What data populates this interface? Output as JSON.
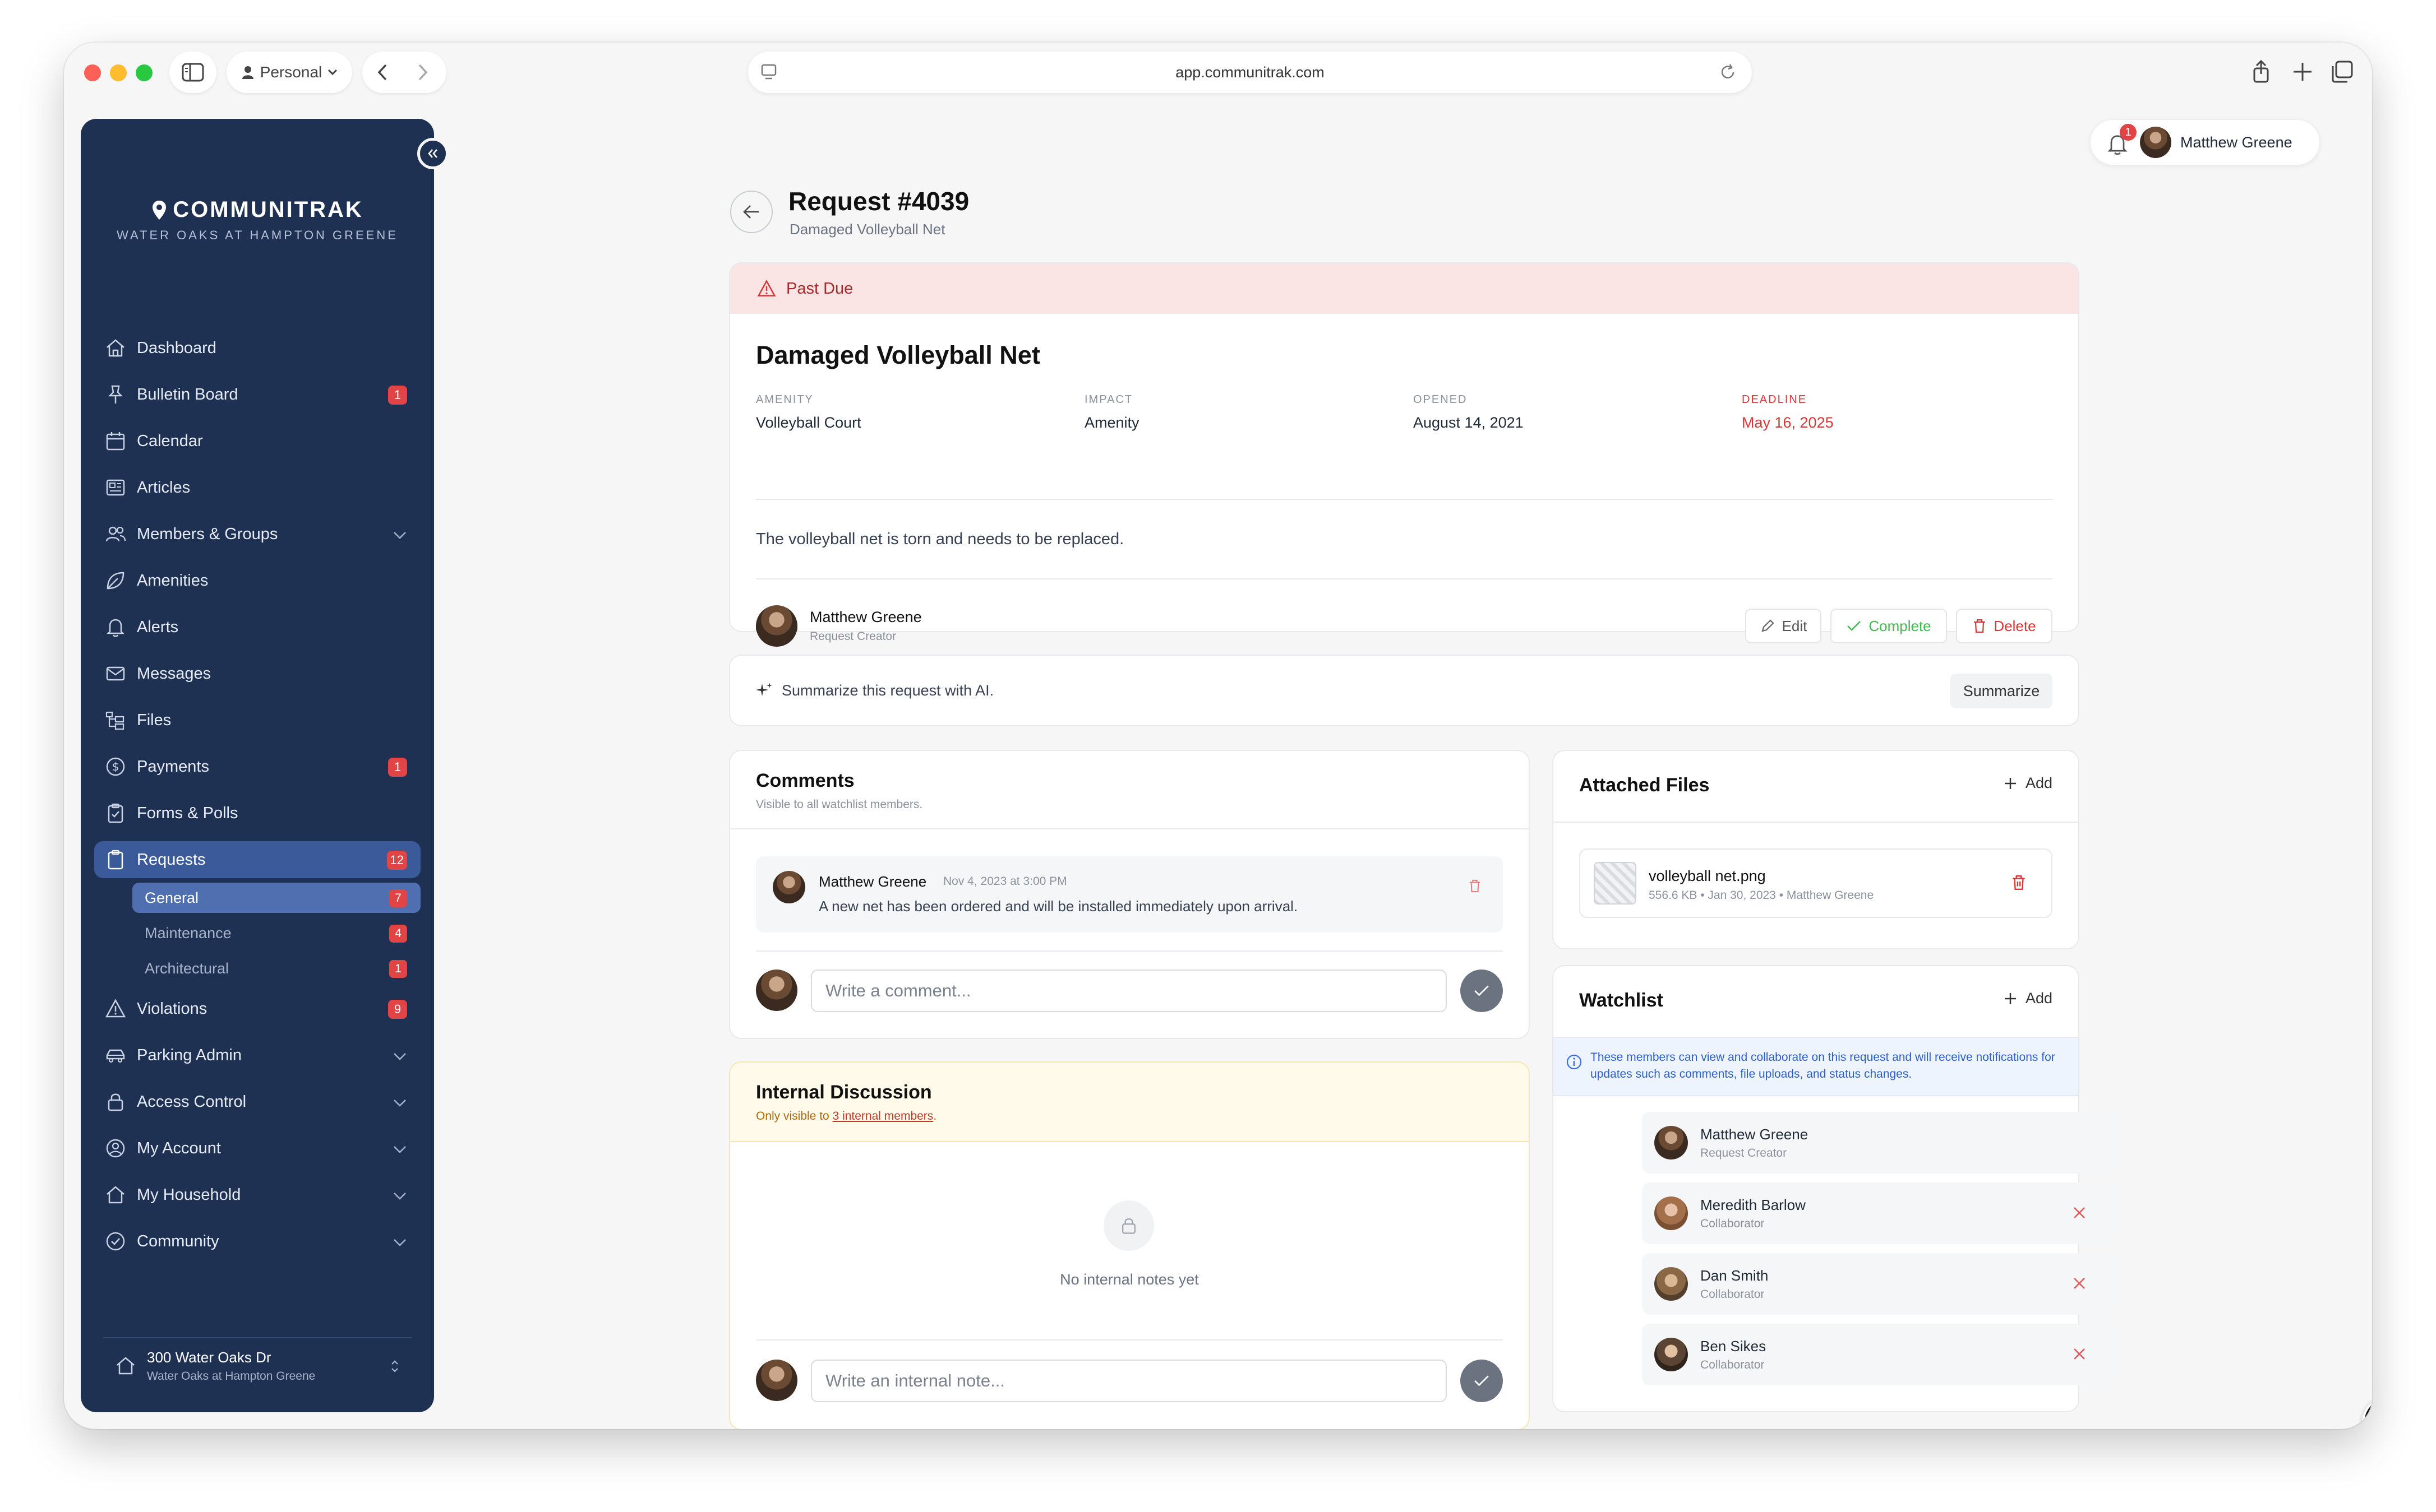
{
  "browser": {
    "profile": "Personal",
    "url": "app.communitrak.com"
  },
  "brand": {
    "name": "COMMUNITRAK",
    "community": "WATER OAKS AT HAMPTON GREENE"
  },
  "nav": {
    "dashboard": "Dashboard",
    "bulletin": "Bulletin Board",
    "bulletin_badge": "1",
    "calendar": "Calendar",
    "articles": "Articles",
    "members": "Members & Groups",
    "amenities": "Amenities",
    "alerts": "Alerts",
    "messages": "Messages",
    "files": "Files",
    "payments": "Payments",
    "payments_badge": "1",
    "forms": "Forms & Polls",
    "requests": "Requests",
    "requests_badge": "12",
    "general": "General",
    "general_badge": "7",
    "maintenance": "Maintenance",
    "maintenance_badge": "4",
    "architectural": "Architectural",
    "architectural_badge": "1",
    "violations": "Violations",
    "violations_badge": "9",
    "parking": "Parking Admin",
    "access": "Access Control",
    "account": "My Account",
    "household": "My Household",
    "community": "Community"
  },
  "footer": {
    "address": "300 Water Oaks Dr",
    "community": "Water Oaks at Hampton Greene"
  },
  "user": {
    "name": "Matthew Greene",
    "notif_count": "1"
  },
  "request": {
    "title": "Request #4039",
    "subtitle": "Damaged Volleyball Net",
    "status": "Past Due",
    "heading": "Damaged Volleyball Net",
    "fields": {
      "amenity_label": "AMENITY",
      "amenity_value": "Volleyball Court",
      "impact_label": "IMPACT",
      "impact_value": "Amenity",
      "opened_label": "OPENED",
      "opened_value": "August 14, 2021",
      "deadline_label": "DEADLINE",
      "deadline_value": "May 16, 2025"
    },
    "description": "The volleyball net is torn and needs to be replaced.",
    "creator_name": "Matthew Greene",
    "creator_role": "Request Creator",
    "edit": "Edit",
    "complete": "Complete",
    "delete": "Delete"
  },
  "ai": {
    "prompt": "Summarize this request with AI.",
    "button": "Summarize"
  },
  "comments": {
    "title": "Comments",
    "subtitle": "Visible to all watchlist members.",
    "items": [
      {
        "author": "Matthew Greene",
        "time": "Nov 4, 2023 at 3:00 PM",
        "text": "A new net has been ordered and will be installed immediately upon arrival."
      }
    ],
    "placeholder": "Write a comment..."
  },
  "internal": {
    "title": "Internal Discussion",
    "subtitle_pre": "Only visible to ",
    "subtitle_link": "3 internal members",
    "subtitle_post": ".",
    "empty": "No internal notes yet",
    "placeholder": "Write an internal note..."
  },
  "files": {
    "title": "Attached Files",
    "add": "Add",
    "items": [
      {
        "name": "volleyball net.png",
        "meta": "556.6 KB • Jan 30, 2023 • Matthew Greene"
      }
    ]
  },
  "watchlist": {
    "title": "Watchlist",
    "add": "Add",
    "info": "These members can view and collaborate on this request and will receive notifications for updates such as comments, file uploads, and status changes.",
    "members": [
      {
        "name": "Matthew Greene",
        "role": "Request Creator"
      },
      {
        "name": "Meredith Barlow",
        "role": "Collaborator"
      },
      {
        "name": "Dan Smith",
        "role": "Collaborator"
      },
      {
        "name": "Ben Sikes",
        "role": "Collaborator"
      }
    ]
  },
  "colors": {
    "sidebar": "#1f3153",
    "danger": "#d93636",
    "success": "#3fb950",
    "past_due_bg": "#fbe4e4",
    "internal_bg": "#fffaea"
  }
}
